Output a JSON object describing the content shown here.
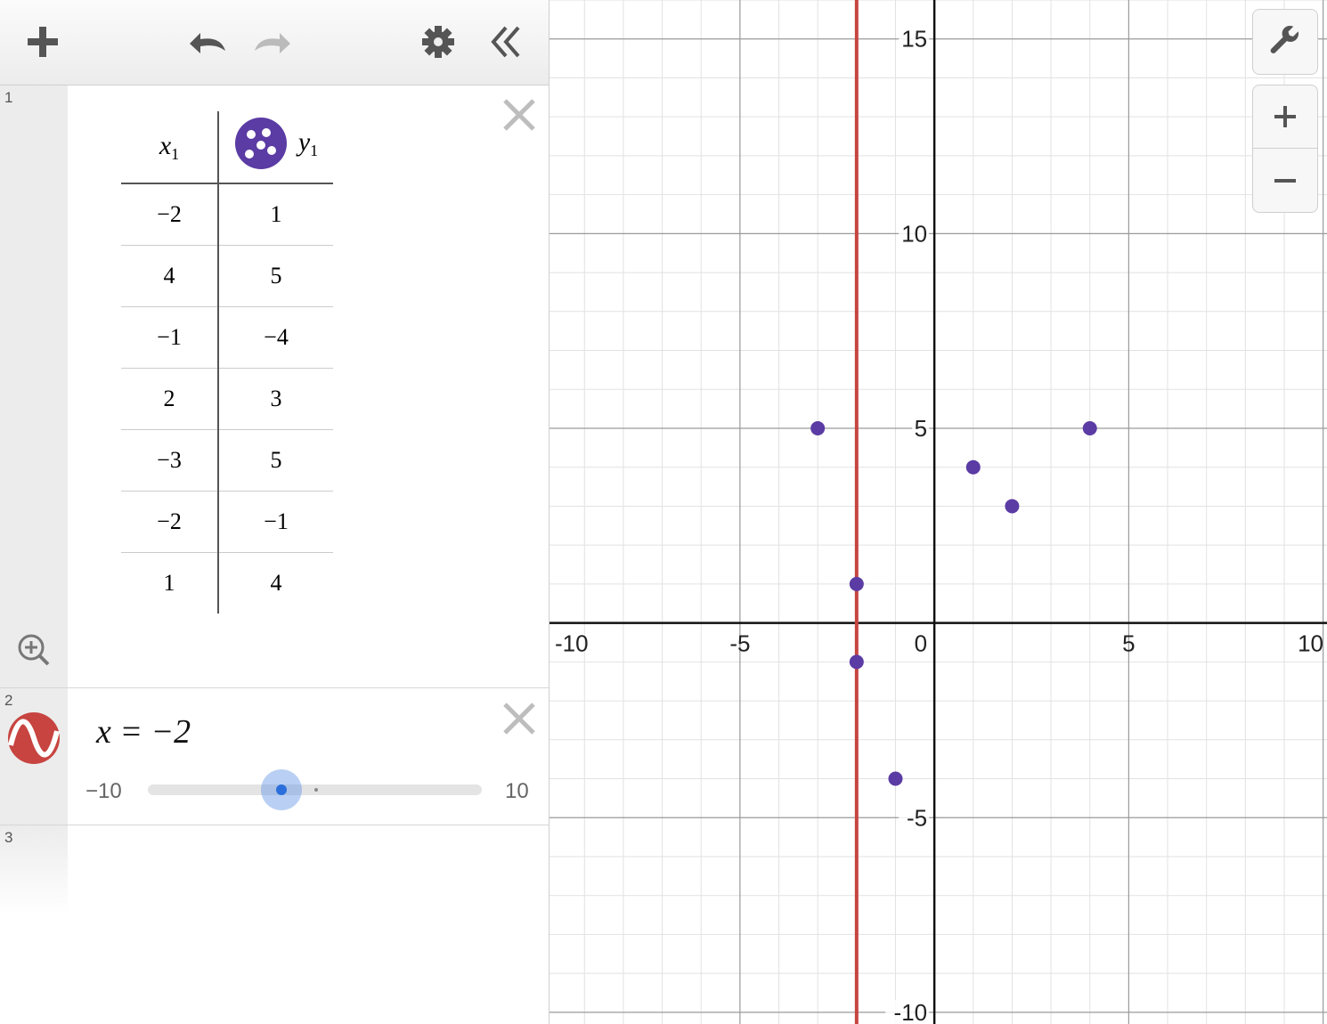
{
  "toolbar": {
    "icons": [
      "plus-icon",
      "undo-icon",
      "redo-icon",
      "gear-icon",
      "collapse-icon"
    ]
  },
  "expressions": [
    {
      "number": "1",
      "type": "table",
      "columns": [
        {
          "var": "x",
          "sub": "1"
        },
        {
          "var": "y",
          "sub": "1"
        }
      ],
      "rows": [
        [
          "−2",
          "1"
        ],
        [
          "4",
          "5"
        ],
        [
          "−1",
          "−4"
        ],
        [
          "2",
          "3"
        ],
        [
          "−3",
          "5"
        ],
        [
          "−2",
          "−1"
        ],
        [
          "1",
          "4"
        ]
      ],
      "color": "#5b3ba4"
    },
    {
      "number": "2",
      "type": "expression",
      "latex_text": "x = −2",
      "color": "#c0392b",
      "slider": {
        "min": "−10",
        "max": "10",
        "value": -2
      }
    },
    {
      "number": "3",
      "type": "empty"
    }
  ],
  "graph": {
    "x_ticks": [
      "-10",
      "-5",
      "0",
      "5",
      "10"
    ],
    "y_ticks": [
      "15",
      "10",
      "5",
      "-5",
      "-10"
    ],
    "buttons": [
      "wrench-icon",
      "zoom-in-icon",
      "zoom-out-icon"
    ]
  },
  "chart_data": {
    "type": "scatter",
    "xlim": [
      -9.9,
      10.1
    ],
    "ylim": [
      -10.3,
      16
    ],
    "grid": true,
    "points": [
      {
        "x": -2,
        "y": 1
      },
      {
        "x": 4,
        "y": 5
      },
      {
        "x": -1,
        "y": -4
      },
      {
        "x": 2,
        "y": 3
      },
      {
        "x": -3,
        "y": 5
      },
      {
        "x": -2,
        "y": -1
      },
      {
        "x": 1,
        "y": 4
      }
    ],
    "point_color": "#5b3ba4",
    "vertical_line": {
      "x": -2,
      "color": "#c74440"
    }
  }
}
